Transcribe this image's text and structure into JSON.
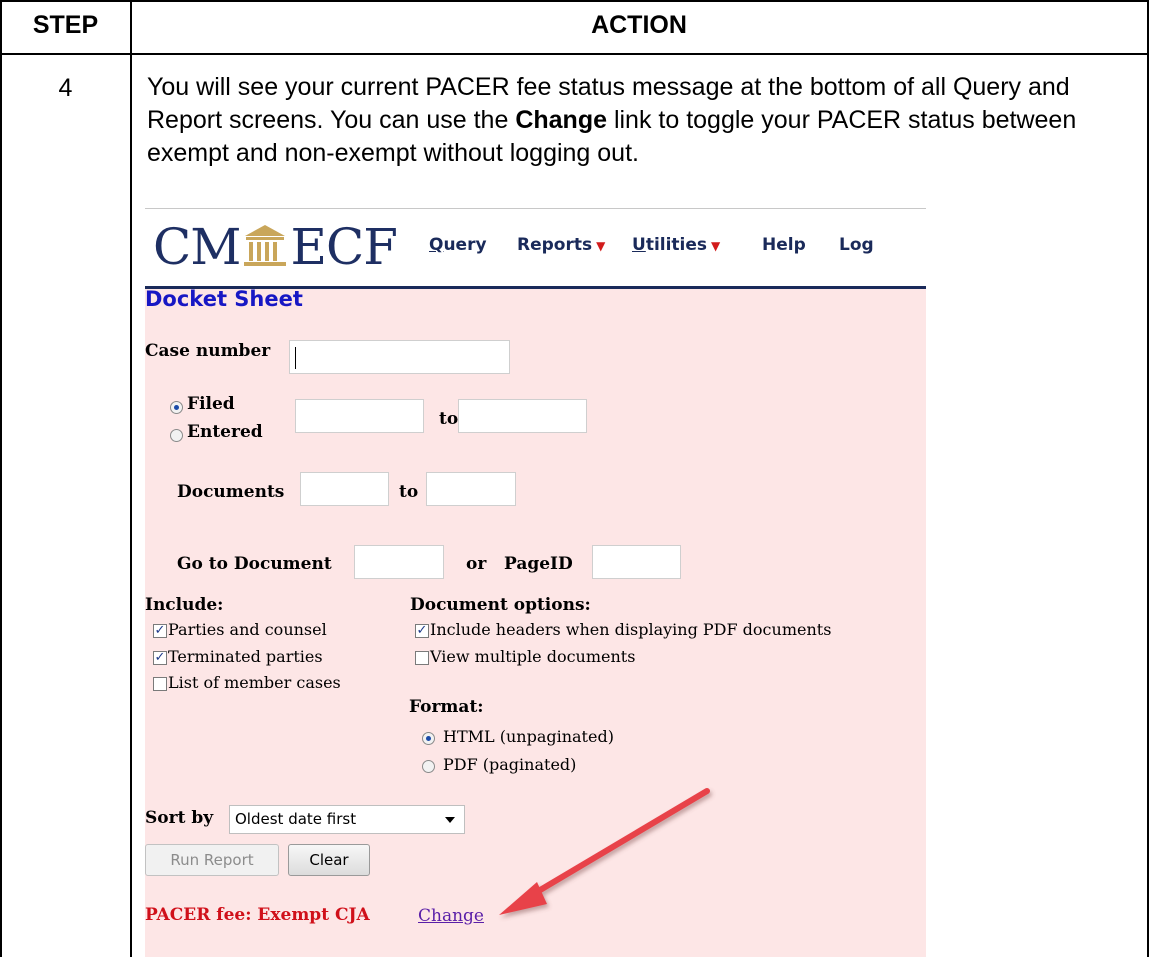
{
  "table": {
    "headers": {
      "step": "STEP",
      "action": "ACTION"
    },
    "row": {
      "step": "4",
      "instruction_prefix": "You will see your current PACER fee status message at the bottom of all Query and Report screens. You can use the ",
      "instruction_bold": "Change",
      "instruction_suffix": " link to toggle your PACER status between exempt and non-exempt without logging out."
    }
  },
  "cmecf": {
    "logo_left": "CM",
    "logo_right": "ECF",
    "nav": {
      "query": {
        "first": "Q",
        "rest": "uery"
      },
      "reports": "Reports",
      "utilities": {
        "first": "U",
        "rest": "tilities"
      },
      "help": "Help",
      "logout": "Log"
    },
    "page_title": "Docket Sheet",
    "form": {
      "case_number_label": "Case number",
      "case_number_value": "",
      "filed_label": "Filed",
      "entered_label": "Entered",
      "date_range_to": "to",
      "documents_label": "Documents",
      "documents_to": "to",
      "go_to_document_label": "Go to Document",
      "or_label": "or",
      "pageid_label": "PageID",
      "include_heading": "Include:",
      "include_options": [
        {
          "label": "Parties and counsel",
          "checked": true
        },
        {
          "label": "Terminated parties",
          "checked": true
        },
        {
          "label": "List of member cases",
          "checked": false
        }
      ],
      "doc_options_heading": "Document options:",
      "doc_options": [
        {
          "label": "Include headers when displaying PDF documents",
          "checked": true
        },
        {
          "label": "View multiple documents",
          "checked": false
        }
      ],
      "format_heading": "Format:",
      "format_options": [
        {
          "label": "HTML (unpaginated)",
          "selected": true
        },
        {
          "label": "PDF (paginated)",
          "selected": false
        }
      ],
      "sort_by_label": "Sort by",
      "sort_by_value": "Oldest date first",
      "run_report_label": "Run Report",
      "clear_label": "Clear"
    },
    "pacer_fee_text": "PACER fee: Exempt CJA",
    "change_link": "Change",
    "colors": {
      "nav_text": "#1a2a5a",
      "title": "#1717c4",
      "background": "#fde6e6",
      "fee": "#d0101a",
      "arrow": "#e8434a"
    }
  }
}
